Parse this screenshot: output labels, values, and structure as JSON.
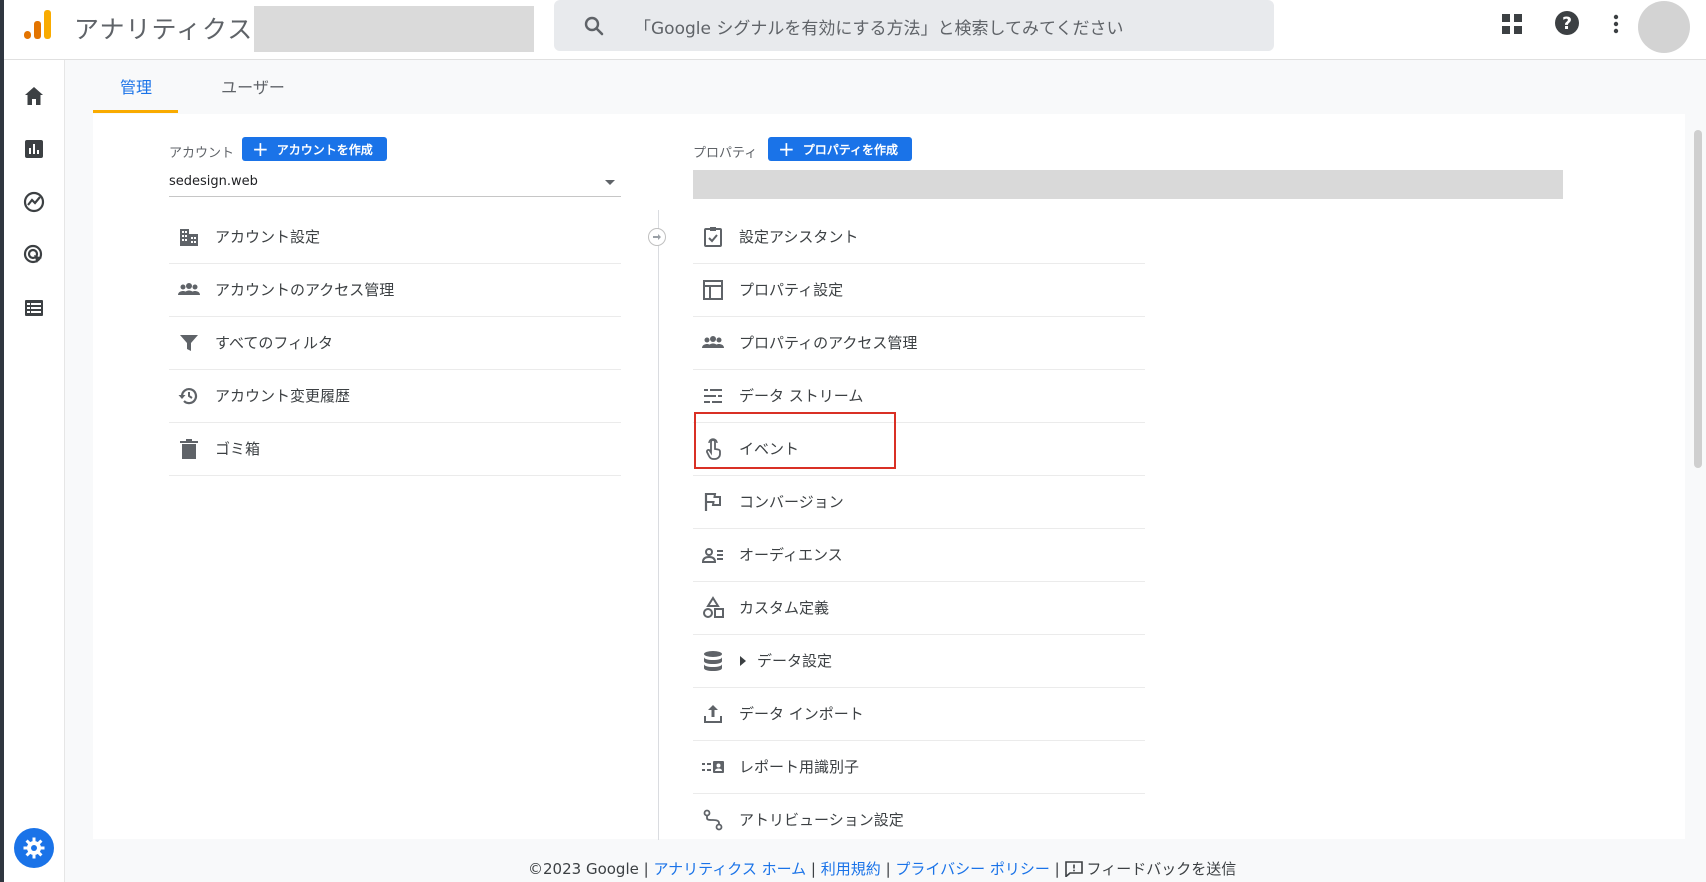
{
  "app": {
    "title": "アナリティクス"
  },
  "search": {
    "placeholder": "「Google シグナルを有効にする方法」と検索してみてください"
  },
  "tabs": [
    {
      "label": "管理",
      "active": true
    },
    {
      "label": "ユーザー",
      "active": false
    }
  ],
  "account": {
    "label": "アカウント",
    "create_label": "アカウントを作成",
    "selected": "sedesign.web",
    "items": [
      {
        "label": "アカウント設定",
        "icon": "building-icon"
      },
      {
        "label": "アカウントのアクセス管理",
        "icon": "people-icon"
      },
      {
        "label": "すべてのフィルタ",
        "icon": "filter-icon"
      },
      {
        "label": "アカウント変更履歴",
        "icon": "history-icon"
      },
      {
        "label": "ゴミ箱",
        "icon": "trash-icon"
      }
    ]
  },
  "property": {
    "label": "プロパティ",
    "create_label": "プロパティを作成",
    "items": [
      {
        "label": "設定アシスタント",
        "icon": "checklist-icon"
      },
      {
        "label": "プロパティ設定",
        "icon": "layout-icon"
      },
      {
        "label": "プロパティのアクセス管理",
        "icon": "people-icon"
      },
      {
        "label": "データ ストリーム",
        "icon": "streams-icon"
      },
      {
        "label": "イベント",
        "icon": "touch-icon"
      },
      {
        "label": "コンバージョン",
        "icon": "flag-icon"
      },
      {
        "label": "オーディエンス",
        "icon": "audience-icon"
      },
      {
        "label": "カスタム定義",
        "icon": "shapes-icon"
      },
      {
        "label": "データ設定",
        "icon": "database-icon"
      },
      {
        "label": "データ インポート",
        "icon": "upload-icon"
      },
      {
        "label": "レポート用識別子",
        "icon": "identity-icon"
      },
      {
        "label": "アトリビューション設定",
        "icon": "attribution-icon"
      }
    ]
  },
  "footer": {
    "copyright": "©2023 Google",
    "sep": "|",
    "links": [
      "アナリティクス ホーム",
      "利用規約",
      "プライバシー ポリシー"
    ],
    "feedback": "フィードバックを送信"
  },
  "colors": {
    "accent": "#1a73e8",
    "highlight": "#d93025",
    "tab_underline": "#f9ab00"
  }
}
